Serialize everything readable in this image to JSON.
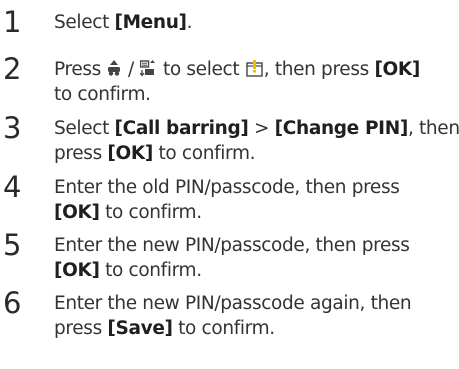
{
  "steps": [
    {
      "number": "1",
      "lines": [
        {
          "pre": "Select ",
          "bold": "[Menu]",
          "post": "."
        }
      ]
    },
    {
      "number": "2",
      "line1": {
        "a": "Press ",
        "sep": " / ",
        "b": " to select ",
        "c": ", then press ",
        "bold": "[OK]"
      },
      "line2": {
        "text": "to confirm."
      },
      "icons": [
        "up-down-nav-icon",
        "phonebook-scroll-icon",
        "settings-menu-icon"
      ]
    },
    {
      "number": "3",
      "line1": {
        "pre": "Select ",
        "bold1": "[Call barring]",
        "mid": " > ",
        "bold2": "[Change PIN]",
        "post": ", then"
      },
      "line2": {
        "pre": "press ",
        "bold": "[OK]",
        "post": " to confirm."
      }
    },
    {
      "number": "4",
      "line1": {
        "text": "Enter the old PIN/passcode, then press"
      },
      "line2": {
        "bold": "[OK]",
        "post": " to confirm."
      }
    },
    {
      "number": "5",
      "line1": {
        "text": "Enter the new PIN/passcode, then press"
      },
      "line2": {
        "bold": "[OK]",
        "post": " to confirm."
      }
    },
    {
      "number": "6",
      "line1": {
        "text": "Enter the new PIN/passcode again, then"
      },
      "line2": {
        "pre": "press ",
        "bold": "[Save]",
        "post": " to confirm."
      }
    }
  ]
}
